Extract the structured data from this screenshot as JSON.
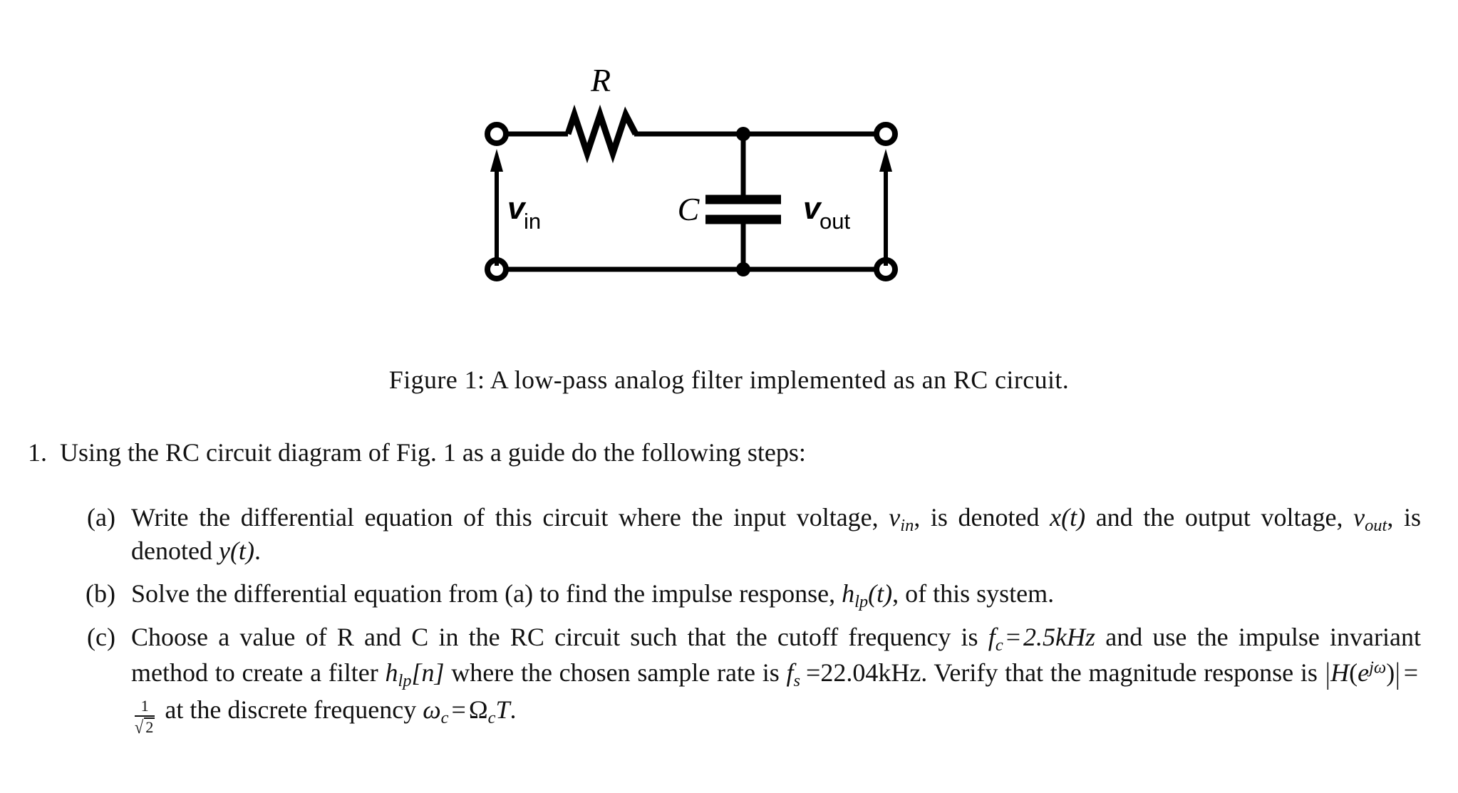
{
  "document": {
    "type": "homework-problem-sheet",
    "figure": {
      "caption": "Figure 1: A low-pass analog filter implemented as an RC circuit.",
      "circuit": {
        "title": "RC low-pass filter",
        "resistor_label": "R",
        "capacitor_label": "C",
        "input_label_base": "v",
        "input_label_sub": "in",
        "output_label_base": "v",
        "output_label_sub": "out",
        "line_color": "#000000",
        "terminals": [
          "input-top",
          "input-bottom",
          "output-top",
          "output-bottom"
        ]
      }
    },
    "items": [
      {
        "marker": "1.",
        "text": "Using the RC circuit diagram of Fig. 1 as a guide do the following steps:"
      }
    ],
    "subitems": [
      {
        "marker": "(a)",
        "text_parts": {
          "p1": "Write the differential equation of this circuit where the input voltage, ",
          "m1_base": "v",
          "m1_sub": "in",
          "p2": ", is denoted ",
          "m2": "x(t)",
          "p3": " and the output voltage, ",
          "m3_base": "v",
          "m3_sub": "out",
          "p4": ", is denoted ",
          "m4": "y(t)",
          "p5": "."
        }
      },
      {
        "marker": "(b)",
        "text_parts": {
          "p1": "Solve the differential equation from (a) to find the impulse response, ",
          "m1_base": "h",
          "m1_sub": "lp",
          "m1_arg": "(t)",
          "p2": ", of this system."
        }
      },
      {
        "marker": "(c)",
        "text_parts": {
          "p1": "Choose a value of R and C in the RC circuit such that the cutoff frequency is ",
          "m1_base": "f",
          "m1_sub": "c",
          "eq1": "=",
          "m1_val": "2.5kHz",
          "p2": " and use the impulse invariant method to create a filter ",
          "m2_base": "h",
          "m2_sub": "lp",
          "m2_arg": "[n]",
          "p3": " where the chosen sample rate is ",
          "m3_base": "f",
          "m3_sub": "s",
          "m3_val": "=22.04kHz.",
          "p4": " Verify that the magnitude response is ",
          "m4_abs_open": "|",
          "m4_base": "H",
          "m4_arg_open": "(",
          "m4_e": "e",
          "m4_exp": "jω",
          "m4_arg_close": ")",
          "m4_abs_close": "|",
          "eq2": "=",
          "frac_num": "1",
          "frac_radical": "√",
          "frac_den": "2",
          "p5": " at the discrete frequency ",
          "m5_w": "ω",
          "m5_w_sub": "c",
          "eq3": "=",
          "m5_omega": "Ω",
          "m5_omega_sub": "c",
          "m5_T": "T",
          "p6": "."
        }
      }
    ]
  }
}
